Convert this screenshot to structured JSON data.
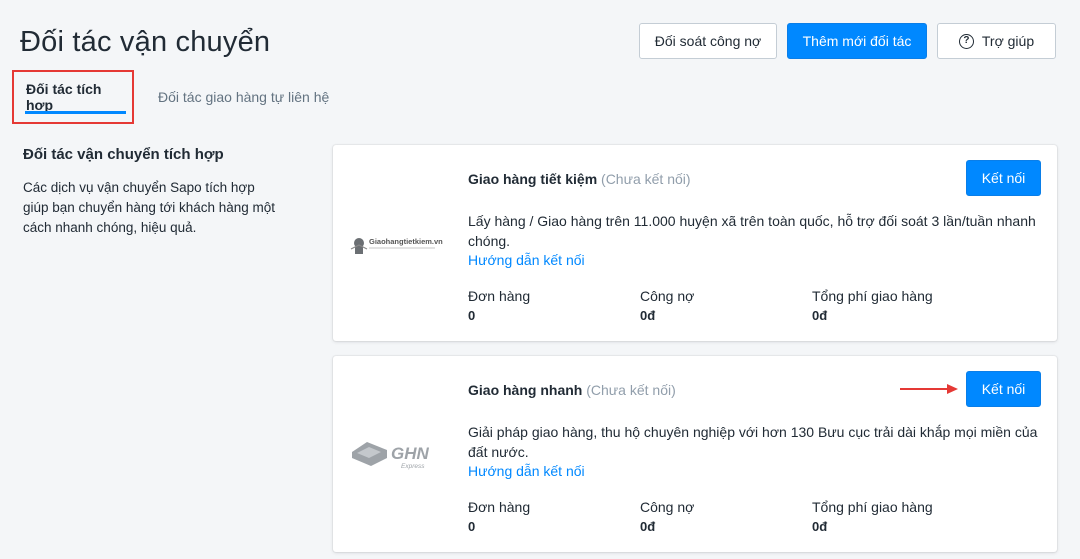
{
  "header": {
    "title": "Đối tác vận chuyển",
    "reconcile_label": "Đối soát công nợ",
    "add_label": "Thêm mới đối tác",
    "help_label": "Trợ giúp",
    "help_icon": "?"
  },
  "tabs": [
    {
      "label": "Đối tác tích hợp",
      "active": true
    },
    {
      "label": "Đối tác giao hàng tự liên hệ",
      "active": false
    }
  ],
  "section": {
    "title": "Đối tác vận chuyển tích hợp",
    "description": "Các dịch vụ vận chuyển Sapo tích hợp giúp bạn chuyển hàng tới khách hàng một cách nhanh chóng, hiệu quả."
  },
  "partners": [
    {
      "name": "Giao hàng tiết kiệm",
      "status": "(Chưa kết nối)",
      "connect_label": "Kết nối",
      "description": "Lấy hàng / Giao hàng trên 11.000 huyện xã trên toàn quốc, hỗ trợ đối soát 3 lần/tuần nhanh chóng.",
      "guide_link": "Hướng dẫn kết nối",
      "logo_text": "Giaohangtietkiem.vn",
      "stats": [
        {
          "label": "Đơn hàng",
          "value": "0"
        },
        {
          "label": "Công nợ",
          "value": "0đ"
        },
        {
          "label": "Tổng phí giao hàng",
          "value": "0đ"
        }
      ]
    },
    {
      "name": "Giao hàng nhanh",
      "status": "(Chưa kết nối)",
      "connect_label": "Kết nối",
      "description": "Giải pháp giao hàng, thu hộ chuyên nghiệp với hơn 130 Bưu cục trải dài khắp mọi miền của đất nước.",
      "guide_link": "Hướng dẫn kết nối",
      "logo_text": "GHN",
      "logo_subtext": "Express",
      "stats": [
        {
          "label": "Đơn hàng",
          "value": "0"
        },
        {
          "label": "Công nợ",
          "value": "0đ"
        },
        {
          "label": "Tổng phí giao hàng",
          "value": "0đ"
        }
      ]
    }
  ],
  "colors": {
    "primary": "#0088ff",
    "highlight": "#e53935",
    "muted": "#919eab"
  }
}
